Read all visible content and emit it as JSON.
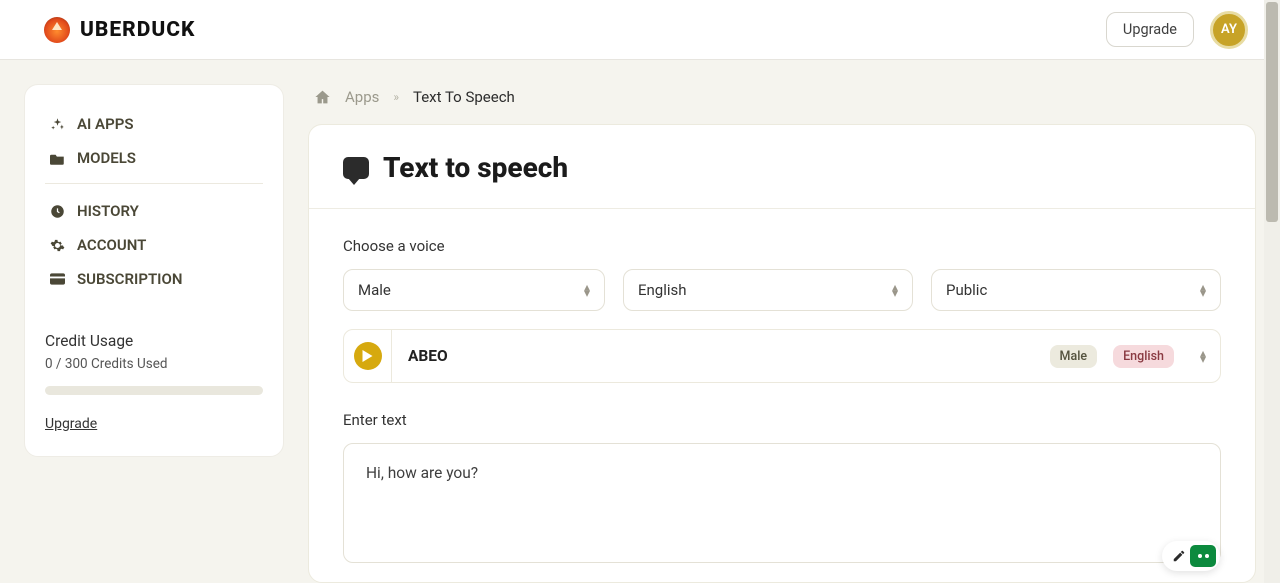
{
  "brand": {
    "name": "UBERDUCK"
  },
  "header": {
    "upgrade_label": "Upgrade",
    "avatar_initials": "AY"
  },
  "sidebar": {
    "items": [
      {
        "label": "AI APPS"
      },
      {
        "label": "MODELS"
      },
      {
        "label": "HISTORY"
      },
      {
        "label": "ACCOUNT"
      },
      {
        "label": "SUBSCRIPTION"
      }
    ],
    "credit": {
      "title": "Credit Usage",
      "value": "0 / 300 Credits Used",
      "upgrade_label": "Upgrade"
    }
  },
  "breadcrumb": {
    "home_label": "Apps",
    "current_label": "Text To Speech"
  },
  "page": {
    "title": "Text to speech",
    "choose_voice_label": "Choose a voice",
    "filters": {
      "gender": "Male",
      "language": "English",
      "visibility": "Public"
    },
    "voice": {
      "name": "ABEO",
      "tag_gender": "Male",
      "tag_language": "English"
    },
    "enter_text_label": "Enter text",
    "text_value": "Hi, how are you?"
  }
}
